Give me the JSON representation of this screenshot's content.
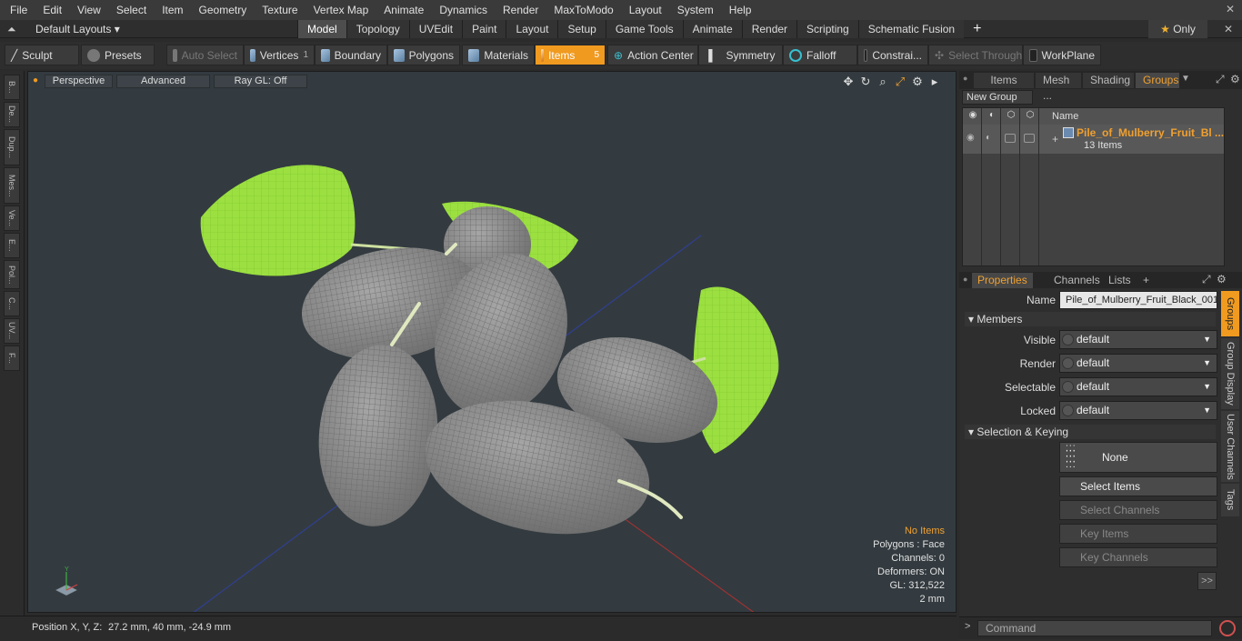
{
  "menubar": {
    "items": [
      "File",
      "Edit",
      "View",
      "Select",
      "Item",
      "Geometry",
      "Texture",
      "Vertex Map",
      "Animate",
      "Dynamics",
      "Render",
      "MaxToModo",
      "Layout",
      "System",
      "Help"
    ],
    "close_icon": "✕"
  },
  "layouts": {
    "label": "Default Layouts ▾"
  },
  "tabs": {
    "items": [
      "Model",
      "Topology",
      "UVEdit",
      "Paint",
      "Layout",
      "Setup",
      "Game Tools",
      "Animate",
      "Render",
      "Scripting",
      "Schematic Fusion"
    ],
    "active": "Model",
    "add": "+",
    "only_label": "Only",
    "only_star": "★"
  },
  "toolbar": {
    "sculpt": "Sculpt",
    "presets": "Presets",
    "auto_select": "Auto Select",
    "vertices": "Vertices",
    "vertices_count": "1",
    "boundary": "Boundary",
    "polygons": "Polygons",
    "materials": "Materials",
    "items": "Items",
    "items_count": "5",
    "action_center": "Action Center",
    "symmetry": "Symmetry",
    "falloff": "Falloff",
    "constraints": "Constrai...",
    "select_through": "Select Through",
    "workplane": "WorkPlane"
  },
  "left_tools": [
    "B...",
    "De...",
    "Dup...",
    "Mes...",
    "Ve...",
    "E...",
    "Pol...",
    "C...",
    "UV...",
    "F..."
  ],
  "viewport": {
    "perspective": "Perspective",
    "advanced": "Advanced",
    "raygl": "Ray GL: Off",
    "stats": {
      "no_items": "No Items",
      "polygons": "Polygons : Face",
      "channels": "Channels: 0",
      "deformers": "Deformers: ON",
      "gl": "GL: 312,522",
      "unit": "2 mm"
    }
  },
  "status": {
    "position_label": "Position X, Y, Z:",
    "position_value": "27.2 mm, 40 mm, -24.9 mm"
  },
  "right_panel": {
    "tabs": [
      "Items",
      "Mesh ...",
      "Shading",
      "Groups"
    ],
    "active_tab": "Groups",
    "new_group": "New Group",
    "list_header_name": "Name",
    "group": {
      "name": "Pile_of_Mulberry_Fruit_Bl ...",
      "count": "13 Items"
    },
    "prop_tabs": [
      "Properties",
      "Channels",
      "Lists",
      "+"
    ],
    "prop_active": "Properties",
    "name_label": "Name",
    "name_value": "Pile_of_Mulberry_Fruit_Black_001",
    "members_label": "Members",
    "visible_label": "Visible",
    "visible_value": "default",
    "render_label": "Render",
    "render_value": "default",
    "selectable_label": "Selectable",
    "selectable_value": "default",
    "locked_label": "Locked",
    "locked_value": "default",
    "sel_keying_label": "Selection & Keying",
    "none_label": "None",
    "select_items": "Select Items",
    "select_channels": "Select Channels",
    "key_items": "Key Items",
    "key_channels": "Key Channels",
    "more": ">>",
    "vtabs": [
      "Groups",
      "Group Display",
      "User Channels",
      "Tags"
    ],
    "command_placeholder": "Command"
  },
  "colors": {
    "accent": "#f09a20",
    "viewport_bg": "#333b40",
    "leaf": "#9be040",
    "fruit": "#8c8c8c"
  }
}
